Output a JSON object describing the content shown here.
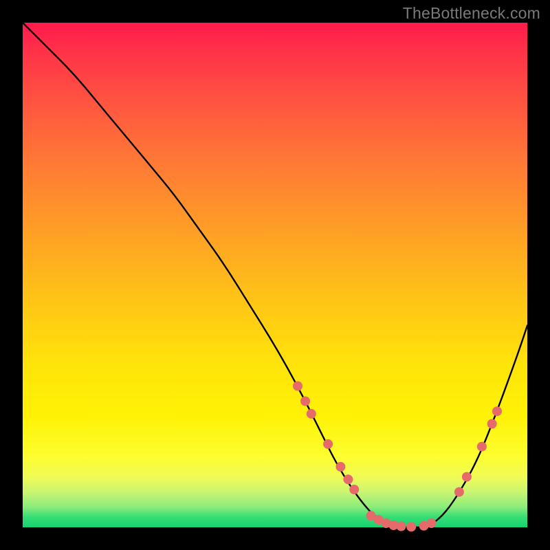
{
  "watermark": "TheBottleneck.com",
  "chart_data": {
    "type": "line",
    "title": "",
    "xlabel": "",
    "ylabel": "",
    "xlim": [
      0,
      100
    ],
    "ylim": [
      0,
      100
    ],
    "series": [
      {
        "name": "bottleneck-curve",
        "x": [
          0,
          5,
          10,
          15,
          20,
          25,
          30,
          35,
          40,
          45,
          50,
          55,
          60,
          62,
          65,
          68,
          70,
          72,
          74,
          76,
          78,
          80,
          83,
          86,
          90,
          94,
          98,
          100
        ],
        "y": [
          100,
          95,
          90,
          84,
          78,
          72,
          66,
          59,
          52,
          44,
          36,
          27,
          17,
          13,
          8,
          4,
          2,
          1,
          0,
          0,
          0,
          0,
          2,
          6,
          13,
          23,
          34,
          40
        ]
      }
    ],
    "markers": [
      {
        "name": "cluster-left-1",
        "x": 54.5,
        "y": 28
      },
      {
        "name": "cluster-left-2",
        "x": 56,
        "y": 25
      },
      {
        "name": "cluster-left-3",
        "x": 57.2,
        "y": 22.5
      },
      {
        "name": "cluster-left-4",
        "x": 60.5,
        "y": 16.5
      },
      {
        "name": "cluster-left-5",
        "x": 63,
        "y": 12
      },
      {
        "name": "cluster-left-6",
        "x": 64.5,
        "y": 9.5
      },
      {
        "name": "cluster-left-7",
        "x": 65.7,
        "y": 7.5
      },
      {
        "name": "bottom-1",
        "x": 69,
        "y": 2.3
      },
      {
        "name": "bottom-2",
        "x": 70.5,
        "y": 1.5
      },
      {
        "name": "bottom-3",
        "x": 72,
        "y": 0.8
      },
      {
        "name": "bottom-4",
        "x": 73.5,
        "y": 0.4
      },
      {
        "name": "bottom-5",
        "x": 75,
        "y": 0.2
      },
      {
        "name": "bottom-6",
        "x": 77,
        "y": 0.1
      },
      {
        "name": "bottom-7",
        "x": 79.5,
        "y": 0.3
      },
      {
        "name": "bottom-8",
        "x": 81,
        "y": 0.8
      },
      {
        "name": "cluster-right-1",
        "x": 86.5,
        "y": 7
      },
      {
        "name": "cluster-right-2",
        "x": 88,
        "y": 10
      },
      {
        "name": "cluster-right-3",
        "x": 91,
        "y": 16
      },
      {
        "name": "cluster-right-4",
        "x": 93,
        "y": 20.5
      },
      {
        "name": "cluster-right-5",
        "x": 94,
        "y": 23
      }
    ],
    "marker_style": {
      "color": "#e76a6a",
      "radius": 7
    }
  }
}
